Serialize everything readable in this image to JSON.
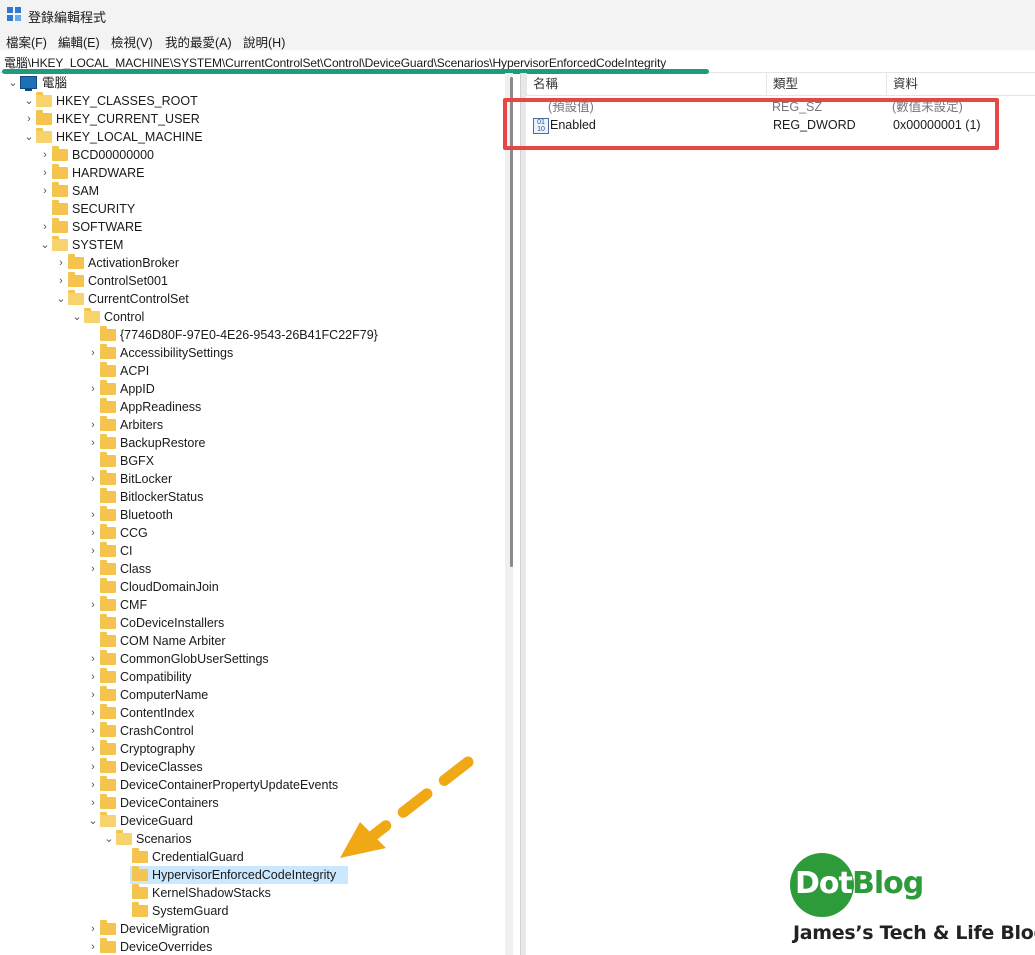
{
  "window": {
    "title": "登錄編輯程式"
  },
  "menu": [
    "檔案(F)",
    "編輯(E)",
    "檢視(V)",
    "我的最愛(A)",
    "說明(H)"
  ],
  "address": "電腦\\HKEY_LOCAL_MACHINE\\SYSTEM\\CurrentControlSet\\Control\\DeviceGuard\\Scenarios\\HypervisorEnforcedCodeIntegrity",
  "tree": {
    "root": "電腦",
    "items": [
      "HKEY_CLASSES_ROOT",
      "HKEY_CURRENT_USER",
      "HKEY_LOCAL_MACHINE",
      "BCD00000000",
      "HARDWARE",
      "SAM",
      "SECURITY",
      "SOFTWARE",
      "SYSTEM",
      "ActivationBroker",
      "ControlSet001",
      "CurrentControlSet",
      "Control",
      "{7746D80F-97E0-4E26-9543-26B41FC22F79}",
      "AccessibilitySettings",
      "ACPI",
      "AppID",
      "AppReadiness",
      "Arbiters",
      "BackupRestore",
      "BGFX",
      "BitLocker",
      "BitlockerStatus",
      "Bluetooth",
      "CCG",
      "CI",
      "Class",
      "CloudDomainJoin",
      "CMF",
      "CoDeviceInstallers",
      "COM Name Arbiter",
      "CommonGlobUserSettings",
      "Compatibility",
      "ComputerName",
      "ContentIndex",
      "CrashControl",
      "Cryptography",
      "DeviceClasses",
      "DeviceContainerPropertyUpdateEvents",
      "DeviceContainers",
      "DeviceGuard",
      "Scenarios",
      "CredentialGuard",
      "HypervisorEnforcedCodeIntegrity",
      "KernelShadowStacks",
      "SystemGuard",
      "DeviceMigration",
      "DeviceOverrides"
    ]
  },
  "columns": {
    "name": "名稱",
    "type": "類型",
    "data": "資料"
  },
  "values": [
    {
      "name": "(預設值)",
      "type": "REG_SZ",
      "data": "(數值未設定)"
    },
    {
      "name": "Enabled",
      "type": "REG_DWORD",
      "data": "0x00000001 (1)"
    }
  ],
  "branding": {
    "logo_left": "Dot",
    "logo_right": "Blog",
    "tagline": "James’s Tech & Life Blog"
  },
  "colors": {
    "highlight": "#e84545",
    "arrow": "#f0a814",
    "underline": "#1f9a7a",
    "brand_green": "#2e9b3a",
    "folder": "#f4c44e",
    "selection": "#cce8ff"
  },
  "icons": {
    "app": "registry-editor-icon",
    "folder": "folder-icon",
    "computer": "computer-icon",
    "value": "dword-value-icon"
  }
}
